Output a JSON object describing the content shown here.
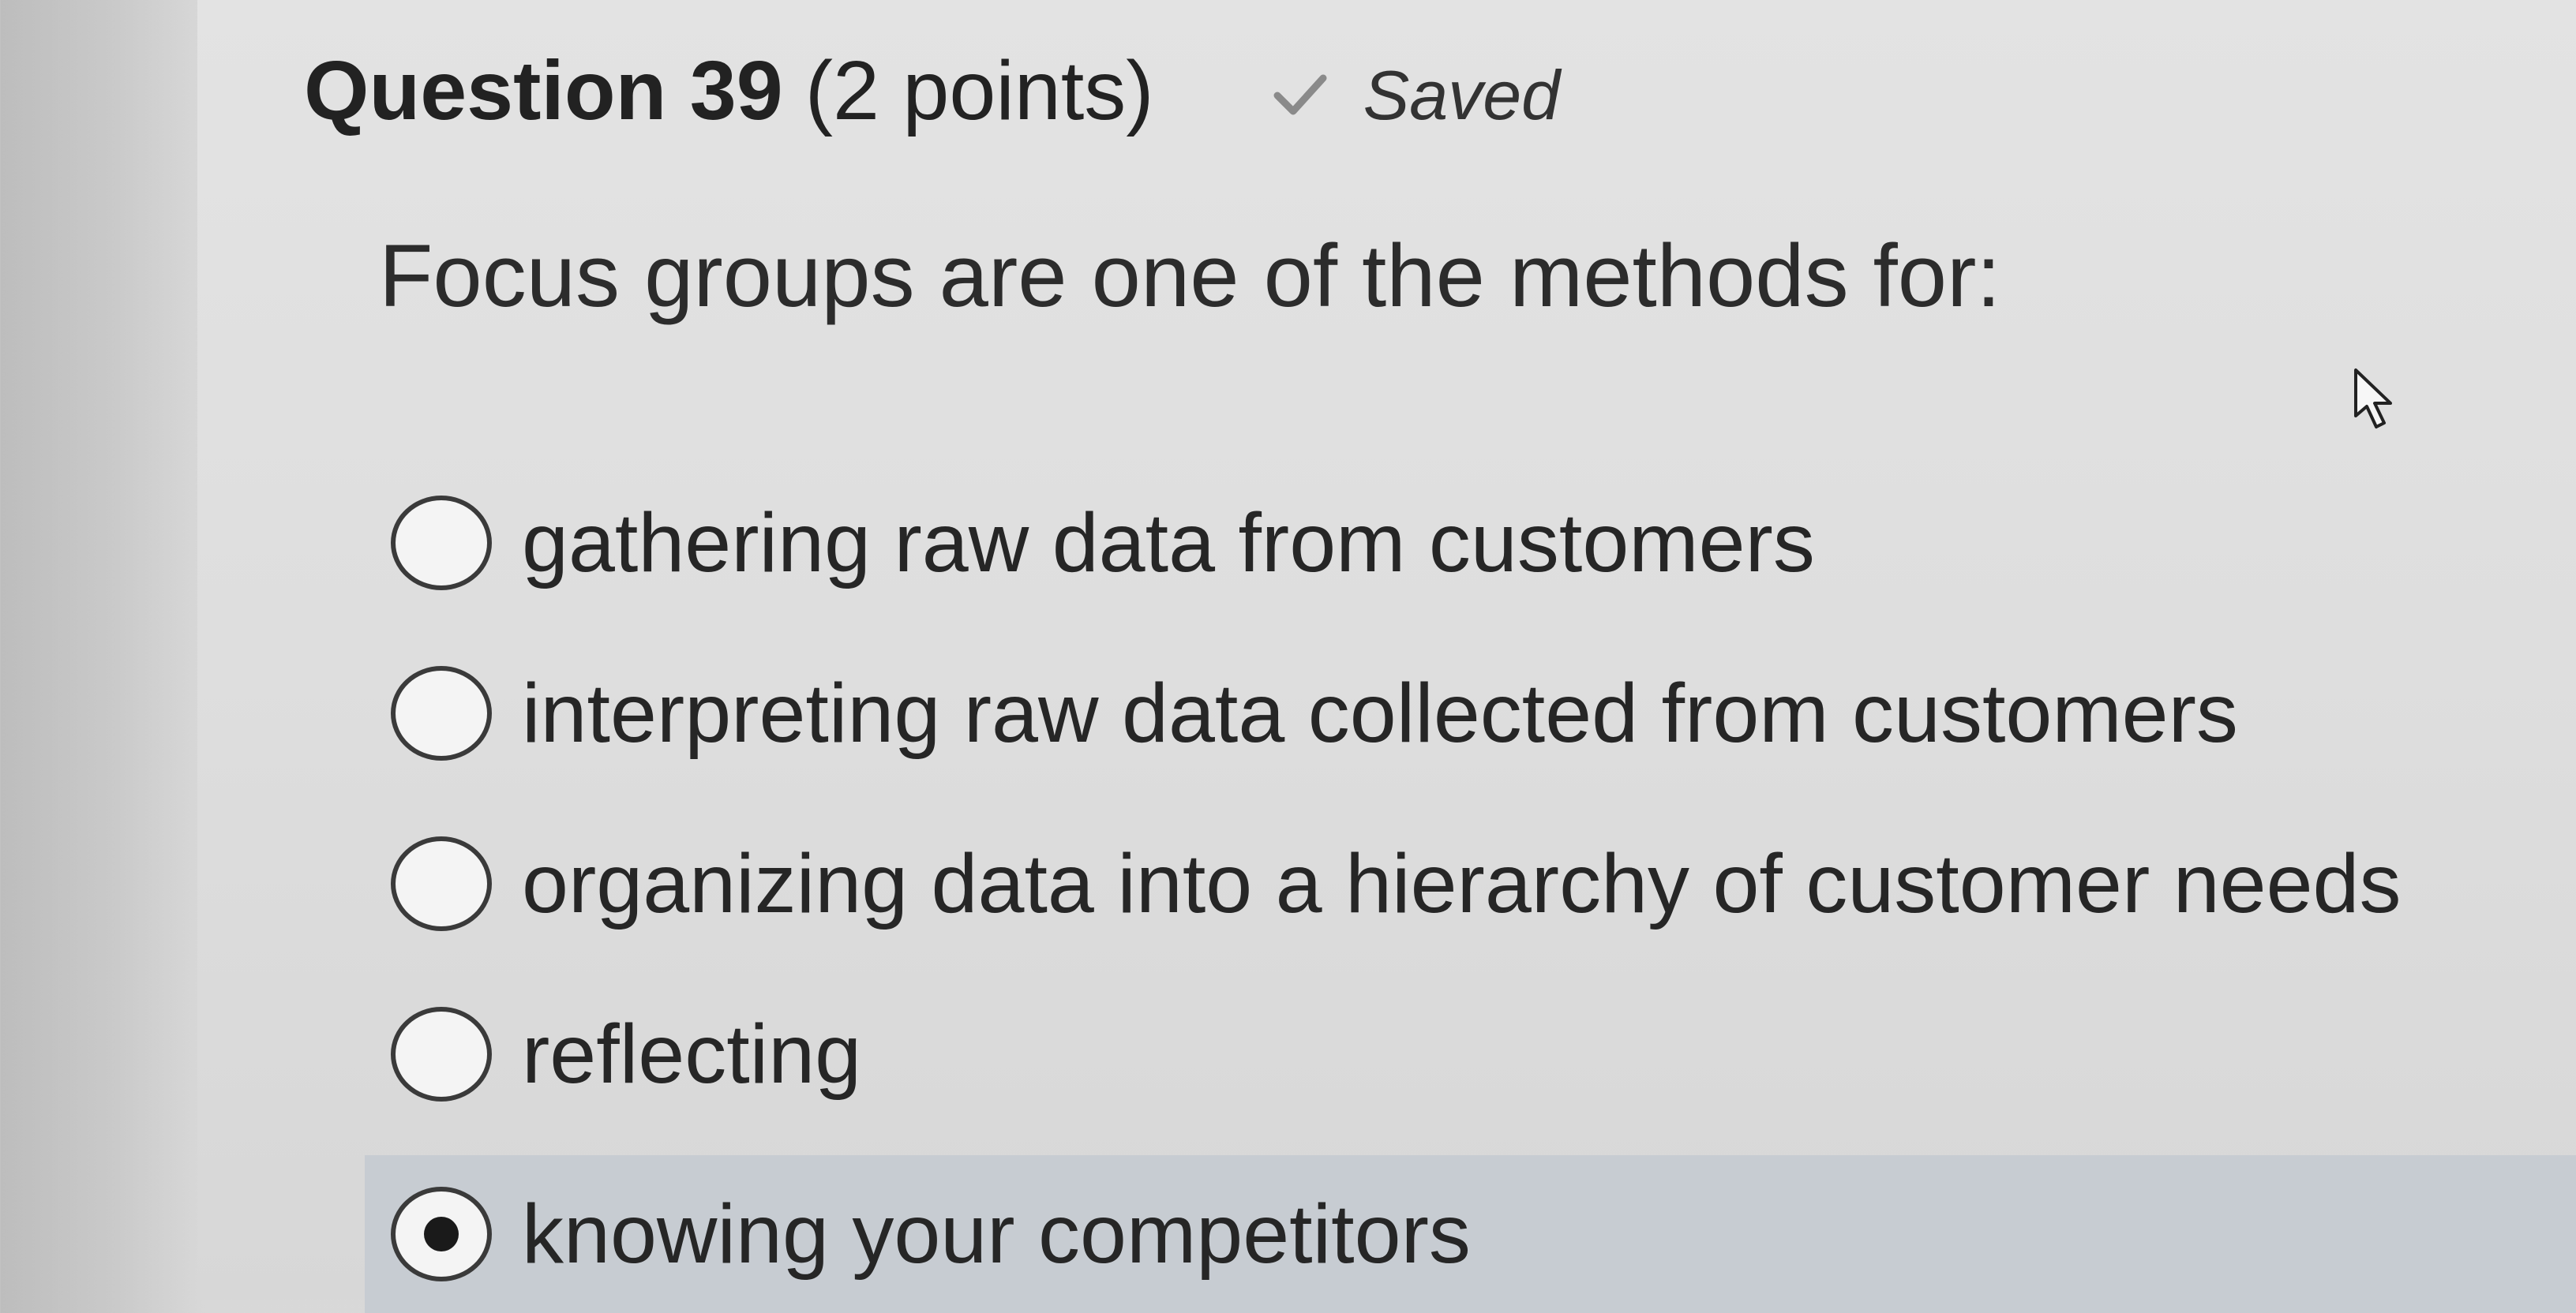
{
  "question": {
    "number_label": "Question 39",
    "points_label": "(2 points)",
    "saved_label": "Saved",
    "status_icon": "check-icon",
    "prompt": "Focus groups are one of the methods for:"
  },
  "options": [
    {
      "label": "gathering raw data from customers",
      "selected": false
    },
    {
      "label": "interpreting raw data collected from customers",
      "selected": false
    },
    {
      "label": "organizing data into a hierarchy of customer needs",
      "selected": false
    },
    {
      "label": "reflecting",
      "selected": false
    },
    {
      "label": "knowing your competitors",
      "selected": true
    }
  ],
  "colors": {
    "selected_row_bg": "#c7ccd2",
    "check_color": "#8a8a8a"
  }
}
